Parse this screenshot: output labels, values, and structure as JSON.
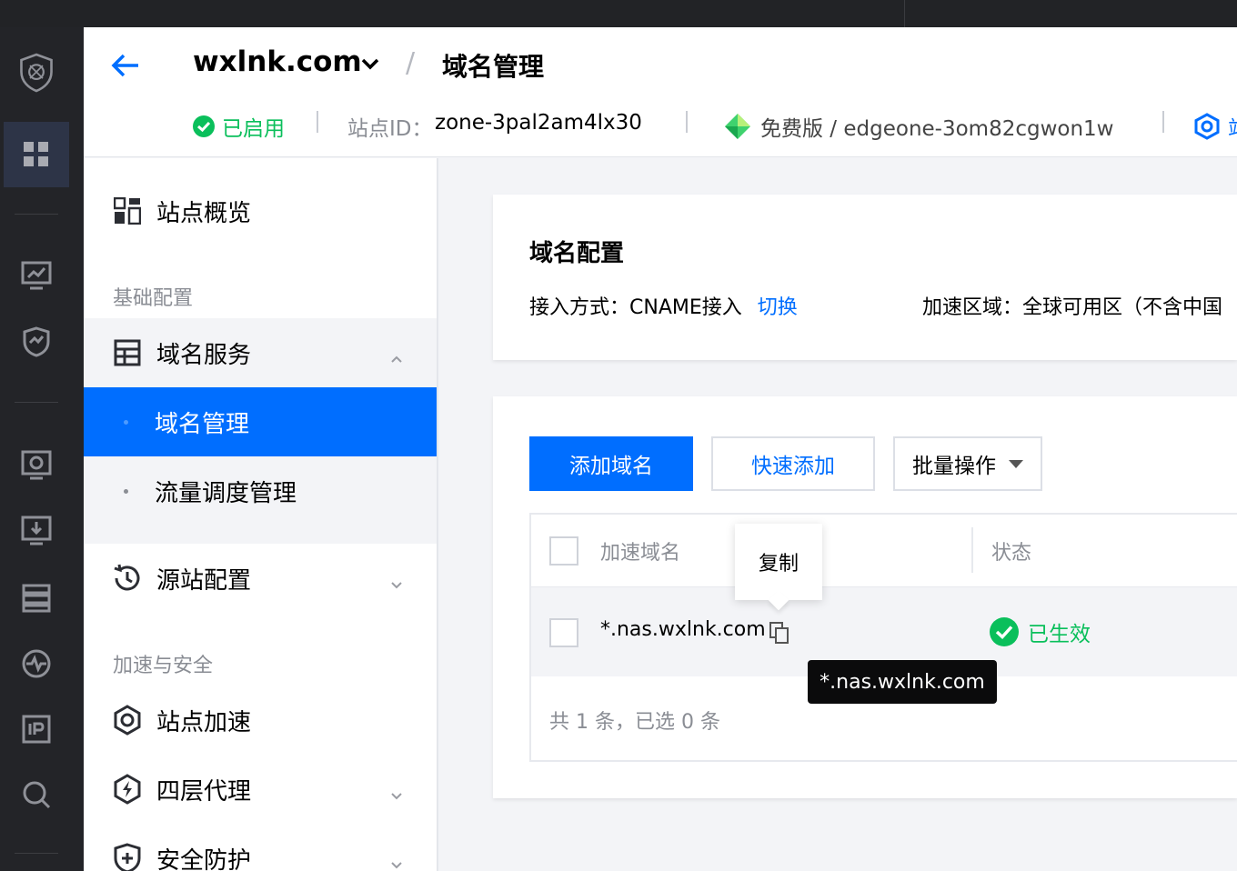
{
  "header": {
    "site_name": "wxlnk.com",
    "crumb_separator": "/",
    "page_title": "域名管理",
    "status": "已启用",
    "zone_label": "站点ID：",
    "zone_id": "zone-3pal2am4lx30",
    "plan": "免费版 / edgeone-3om82cgwon1w",
    "site_truncated": "站"
  },
  "sidenav": {
    "overview": "站点概览",
    "group_basic": "基础配置",
    "domain_service": "域名服务",
    "domain_manage": "域名管理",
    "traffic": "流量调度管理",
    "origin": "源站配置",
    "group_accel": "加速与安全",
    "site_accel": "站点加速",
    "l4_proxy": "四层代理",
    "security": "安全防护"
  },
  "config_card": {
    "title": "域名配置",
    "access_label": "接入方式：CNAME接入",
    "switch_link": "切换",
    "region": "加速区域：全球可用区（不含中国"
  },
  "list_card": {
    "add_button": "添加域名",
    "quick_add_button": "快速添加",
    "batch_button": "批量操作",
    "columns": [
      "加速域名",
      "状态"
    ],
    "rows": [
      {
        "domain": "*.nas.wxlnk.com",
        "status": "已生效"
      }
    ],
    "footer": "共 1 条，已选 0 条"
  },
  "tooltips": {
    "copy": "复制",
    "domain_full": "*.nas.wxlnk.com"
  },
  "colors": {
    "primary": "#006eff",
    "success": "#0abf5b",
    "rail": "#232428"
  }
}
